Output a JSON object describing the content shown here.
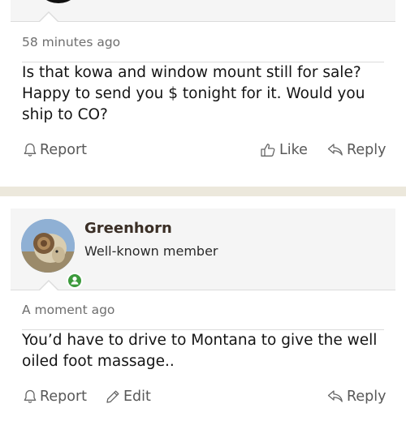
{
  "post1": {
    "time": "58 minutes ago",
    "message": "Is that kowa and window mount still for sale? Happy to send you $ tonight for it. Would you ship to CO?",
    "actions": {
      "report": "Report",
      "like": "Like",
      "reply": "Reply"
    }
  },
  "post2": {
    "username": "Greenhorn",
    "user_title": "Well-known member",
    "time": "A moment ago",
    "message": "You’d have to drive to Montana to give the well oiled foot massage..",
    "actions": {
      "report": "Report",
      "edit": "Edit",
      "reply": "Reply"
    }
  },
  "colors": {
    "page_bg": "#ece8dc",
    "username": "#3a2e25",
    "online": "#3c9a3c",
    "muted": "#6e6e6e"
  },
  "icons": [
    "bell-icon",
    "thumbs-up-icon",
    "reply-icon",
    "pencil-icon",
    "user-online-icon"
  ]
}
